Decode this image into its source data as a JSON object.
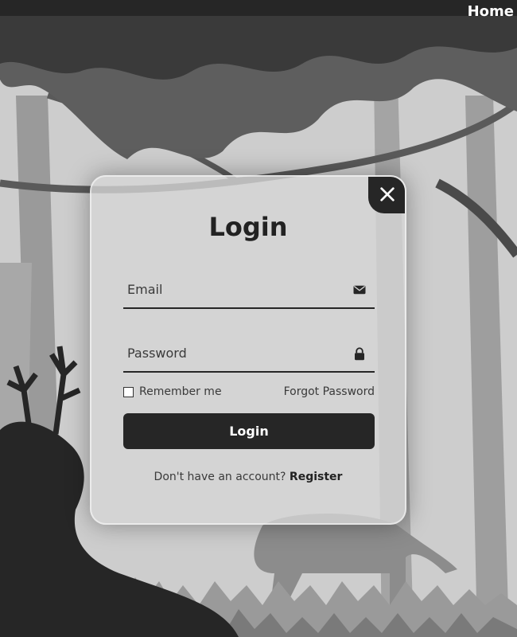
{
  "nav": {
    "home_label": "Home"
  },
  "login": {
    "title": "Login",
    "email_placeholder": "Email",
    "email_icon": "envelope-icon",
    "password_placeholder": "Password",
    "password_icon": "lock-icon",
    "remember_label": "Remember me",
    "remember_checked": false,
    "forgot_label": "Forgot Password",
    "submit_label": "Login",
    "register_prompt": "Don't have an account?",
    "register_label": "Register",
    "close_icon": "close-icon"
  },
  "colors": {
    "dark": "#262626",
    "card_bg": "#d6d6d6",
    "text": "#222222"
  }
}
